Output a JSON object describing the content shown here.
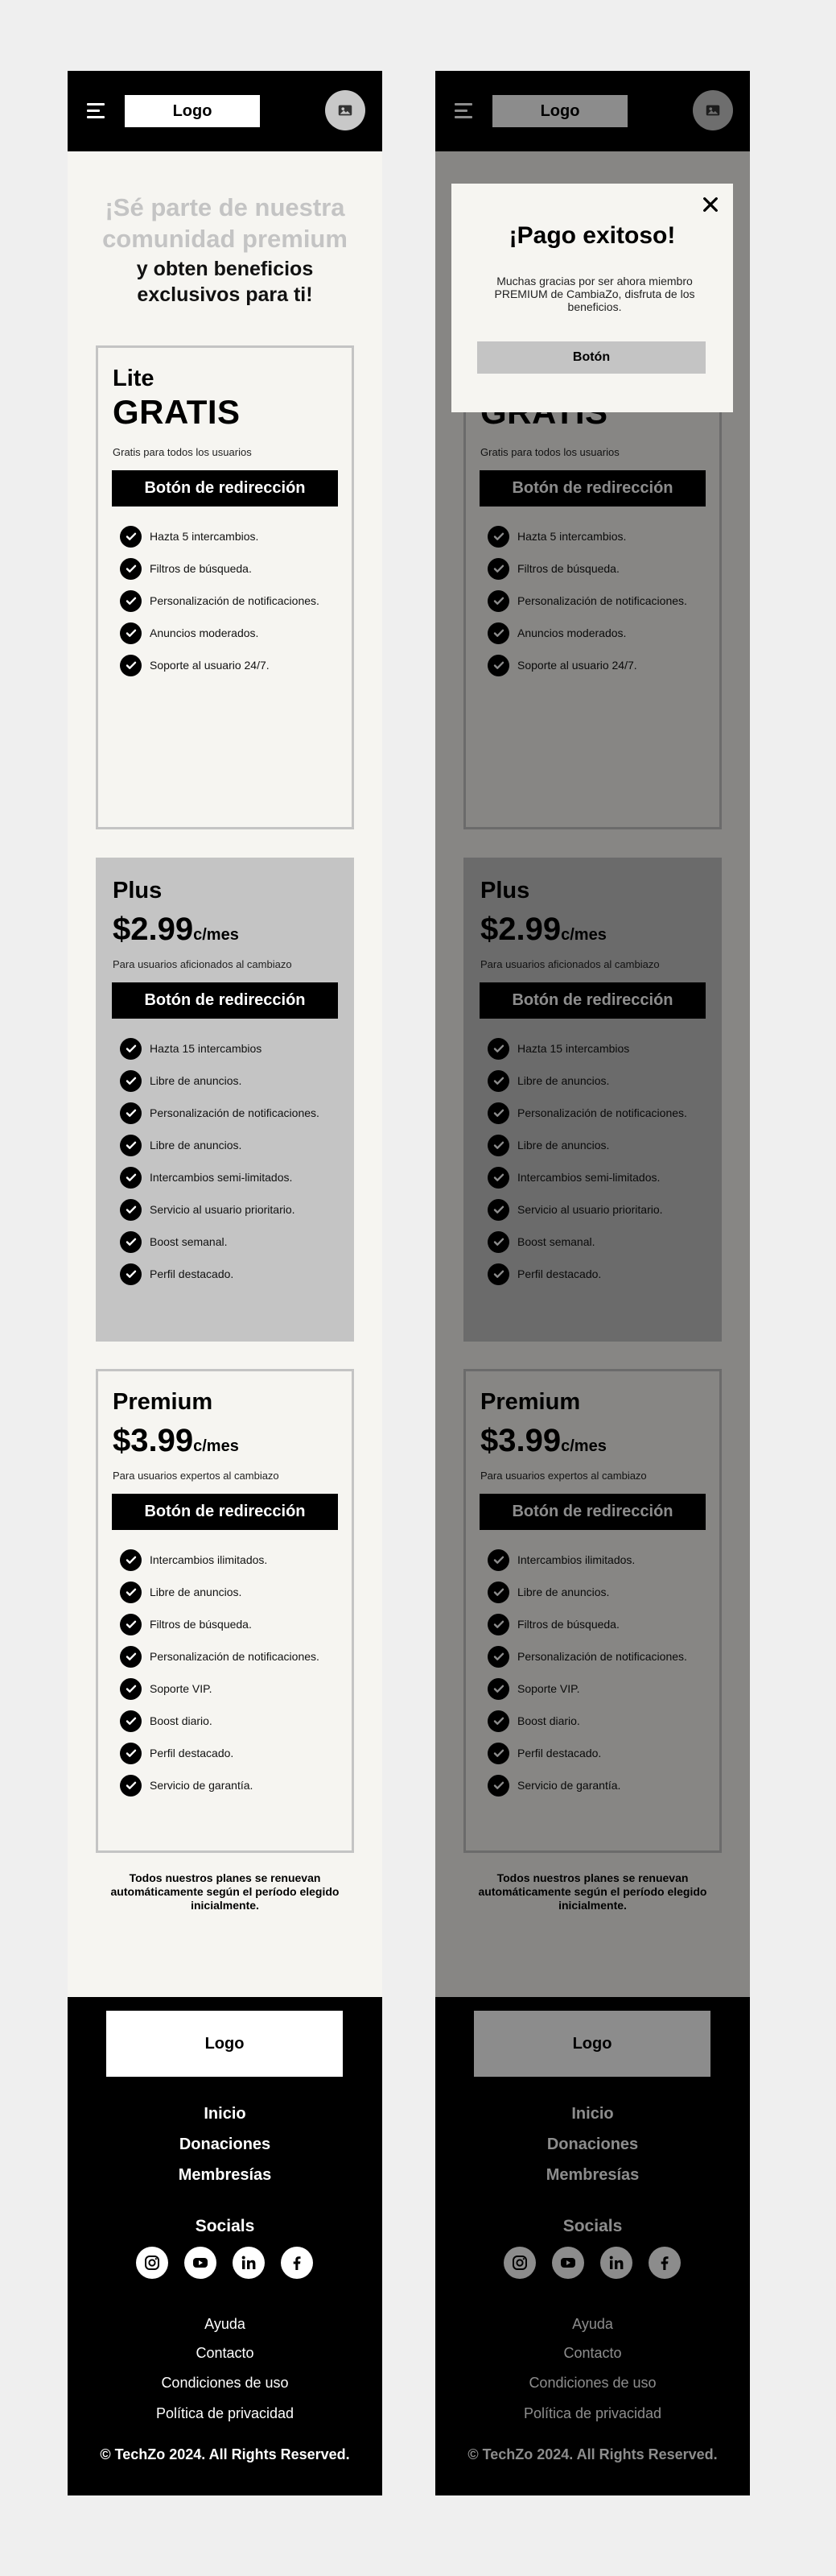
{
  "header": {
    "logo": "Logo",
    "menu_icon": "hamburger-icon",
    "avatar_icon": "image-icon"
  },
  "hero": {
    "title": "¡Sé parte de nuestra comunidad premium",
    "subtitle": "y obten beneficios exclusivos para ti!"
  },
  "plans": [
    {
      "name": "Lite",
      "price": "GRATIS",
      "unit": "",
      "description": "Gratis para todos los usuarios",
      "cta": "Botón de redirección",
      "features": [
        "Hazta 5 intercambios.",
        "Filtros de búsqueda.",
        "Personalización de notificaciones.",
        "Anuncios moderados.",
        "Soporte al usuario 24/7."
      ]
    },
    {
      "name": "Plus",
      "price": "$2.99",
      "unit": "c/mes",
      "description": "Para usuarios aficionados al cambiazo",
      "cta": "Botón de redirección",
      "features": [
        "Hazta 15 intercambios",
        "Libre de anuncios.",
        "Personalización de notificaciones.",
        "Libre de anuncios.",
        "Intercambios semi-limitados.",
        "Servicio al usuario prioritario.",
        "Boost semanal.",
        "Perfil destacado."
      ]
    },
    {
      "name": "Premium",
      "price": "$3.99",
      "unit": "c/mes",
      "description": "Para usuarios expertos al cambiazo",
      "cta": "Botón de redirección",
      "features": [
        "Intercambios ilimitados.",
        "Libre de anuncios.",
        "Filtros de búsqueda.",
        "Personalización de notificaciones.",
        "Soporte VIP.",
        "Boost diario.",
        "Perfil destacado.",
        "Servicio de garantía."
      ]
    }
  ],
  "renewal_note": "Todos nuestros planes se renuevan automáticamente según el período elegido inicialmente.",
  "footer": {
    "logo": "Logo",
    "nav": [
      "Inicio",
      "Donaciones",
      "Membresías"
    ],
    "socials_title": "Socials",
    "social_icons": [
      "instagram-icon",
      "youtube-icon",
      "linkedin-icon",
      "facebook-icon"
    ],
    "links": [
      "Ayuda",
      "Contacto",
      "Condiciones de uso",
      "Política de privacidad"
    ],
    "copyright": "© TechZo 2024. All Rights Reserved."
  },
  "modal": {
    "title": "¡Pago exitoso!",
    "text": "Muchas gracias por ser ahora miembro PREMIUM de CambiaZo, disfruta de los beneficios.",
    "button": "Botón",
    "close_icon": "close-icon"
  },
  "colors": {
    "black": "#000000",
    "gray": "#c4c4c4",
    "background": "#f6f5f1",
    "canvas": "#efefef"
  }
}
